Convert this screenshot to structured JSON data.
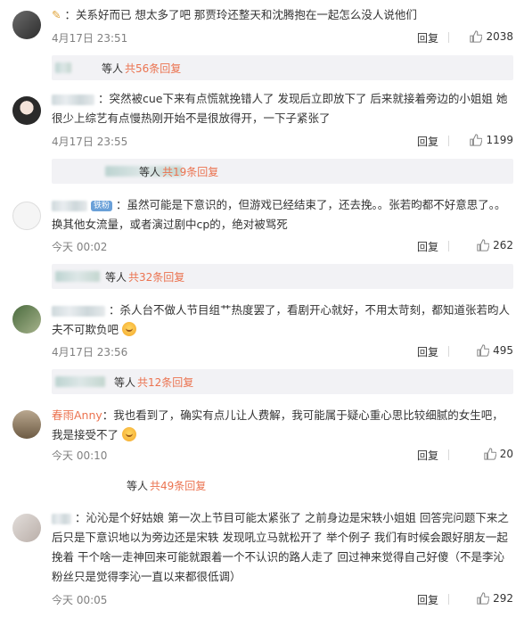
{
  "like_icon": "thumbs-up-icon",
  "comments": [
    {
      "text": "：关系好而已 想太多了吧 那贾玲还整天和沈腾抱在一起怎么没人说他们",
      "time": "4月17日 23:51",
      "reply_label": "回复",
      "likes": "2038",
      "sub": {
        "who": "等人",
        "count": "共56条回复"
      }
    },
    {
      "text": "：突然被cue下来有点慌就挽错人了 发现后立即放下了 后来就接着旁边的小姐姐 她很少上综艺有点慢热刚开始不是很放得开，一下子紧张了",
      "time": "4月17日 23:55",
      "reply_label": "回复",
      "likes": "1199",
      "sub": {
        "who": "等人",
        "count": "共19条回复"
      }
    },
    {
      "badge": "铁粉",
      "text": "：虽然可能是下意识的，但游戏已经结束了，还去挽。。张若昀都不好意思了。。换其他女流量，或者演过剧中cp的，绝对被骂死",
      "time": "今天 00:02",
      "reply_label": "回复",
      "likes": "262",
      "sub": {
        "who": "等人",
        "count": "共32条回复"
      }
    },
    {
      "text": "：杀人台不做人节目组艹热度罢了，看剧开心就好，不用太苛刻，都知道张若昀人夫不可欺负吧",
      "time": "4月17日 23:56",
      "reply_label": "回复",
      "likes": "495",
      "sub": {
        "who": "等人",
        "count": "共12条回复"
      }
    },
    {
      "username": "春雨Anny",
      "text": "：我也看到了，确实有点儿让人费解，我可能属于疑心重心思比较细腻的女生吧，我是接受不了",
      "time": "今天 00:10",
      "reply_label": "回复",
      "likes": "20",
      "sub": {
        "who": "等人",
        "count": "共49条回复"
      }
    },
    {
      "text": "：沁沁是个好姑娘 第一次上节目可能太紧张了 之前身边是宋轶小姐姐 回答完问题下来之后只是下意识地以为旁边还是宋轶 发现吼立马就松开了 举个例子 我们有时候会跟好朋友一起挽着 干个啥一走神回来可能就跟着一个不认识的路人走了  回过神来觉得自己好傻（不是李沁粉丝只是觉得李沁一直以来都很低调）",
      "time": "今天 00:05",
      "reply_label": "回复",
      "likes": "292"
    }
  ]
}
